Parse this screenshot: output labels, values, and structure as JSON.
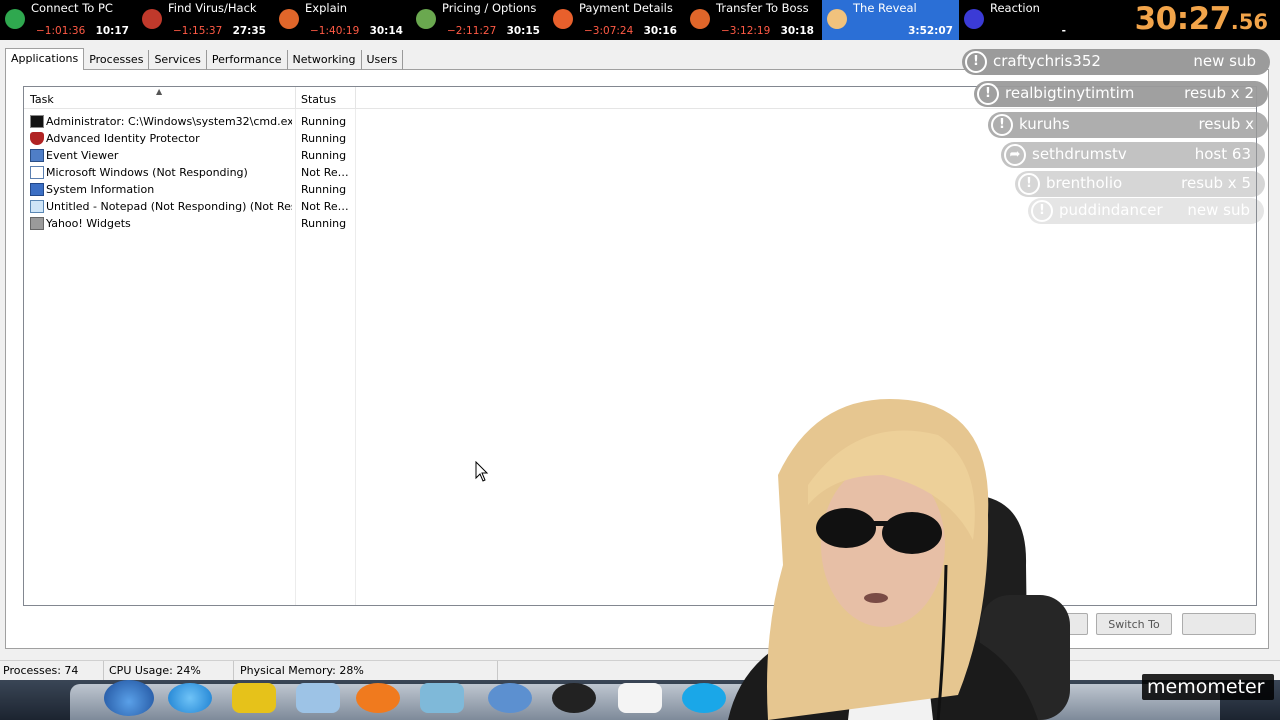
{
  "splits": [
    {
      "name": "Connect To PC",
      "delta": "−1:01:36",
      "time": "10:17",
      "icon": "shield-icon",
      "icon_color": "#2fa84f"
    },
    {
      "name": "Find Virus/Hack",
      "delta": "−1:15:37",
      "time": "27:35",
      "icon": "face-icon",
      "icon_color": "#c0392b"
    },
    {
      "name": "Explain",
      "delta": "−1:40:19",
      "time": "30:14",
      "icon": "folder-icon",
      "icon_color": "#e0662a"
    },
    {
      "name": "Pricing / Options",
      "delta": "−2:11:27",
      "time": "30:15",
      "icon": "money-icon",
      "icon_color": "#6aa84f"
    },
    {
      "name": "Payment Details",
      "delta": "−3:07:24",
      "time": "30:16",
      "icon": "fire-icon",
      "icon_color": "#e8602c"
    },
    {
      "name": "Transfer To Boss",
      "delta": "−3:12:19",
      "time": "30:18",
      "icon": "folder-icon",
      "icon_color": "#e0662a"
    },
    {
      "name": "The Reveal",
      "delta": "",
      "time": "3:52:07",
      "icon": "face-icon",
      "icon_color": "#f1c27d",
      "active": true
    },
    {
      "name": "Reaction",
      "delta": "",
      "time": "-",
      "icon": "face-icon",
      "icon_color": "#3b3bd6"
    }
  ],
  "timer": {
    "main": "30:27",
    "fraction": ".56",
    "color": "#f2a44a"
  },
  "tabs": [
    "Applications",
    "Processes",
    "Services",
    "Performance",
    "Networking",
    "Users"
  ],
  "active_tab": "Applications",
  "list": {
    "columns": {
      "task": "Task",
      "status": "Status"
    },
    "rows": [
      {
        "task": "Administrator: C:\\Windows\\system32\\cmd.exe",
        "status": "Running",
        "icon": "cmd-icon"
      },
      {
        "task": "Advanced Identity Protector",
        "status": "Running",
        "icon": "shield-icon"
      },
      {
        "task": "Event Viewer",
        "status": "Running",
        "icon": "event-viewer-icon"
      },
      {
        "task": "Microsoft Windows (Not Responding)",
        "status": "Not Re…",
        "icon": "window-icon"
      },
      {
        "task": "System Information",
        "status": "Running",
        "icon": "system-info-icon"
      },
      {
        "task": "Untitled - Notepad (Not Responding) (Not Respo…",
        "status": "Not Re…",
        "icon": "notepad-icon"
      },
      {
        "task": "Yahoo! Widgets",
        "status": "Running",
        "icon": "widgets-icon"
      }
    ]
  },
  "buttons": {
    "switch_to": "Switch To"
  },
  "statusbar": {
    "processes": "Processes: 74",
    "cpu": "CPU Usage: 24%",
    "memory": "Physical Memory: 28%"
  },
  "alerts": [
    {
      "user": "craftychris352",
      "type": "new sub",
      "icon": "alert-icon"
    },
    {
      "user": "realbigtinytimtim",
      "type": "resub x 2",
      "icon": "alert-icon"
    },
    {
      "user": "kuruhs",
      "type": "resub x",
      "icon": "alert-icon"
    },
    {
      "user": "sethdrumstv",
      "type": "host 63",
      "icon": "share-icon"
    },
    {
      "user": "brentholio",
      "type": "resub x 5",
      "icon": "alert-icon"
    },
    {
      "user": "puddindancer",
      "type": "new sub",
      "icon": "alert-icon"
    }
  ],
  "overlay": {
    "brand": "memometer"
  }
}
